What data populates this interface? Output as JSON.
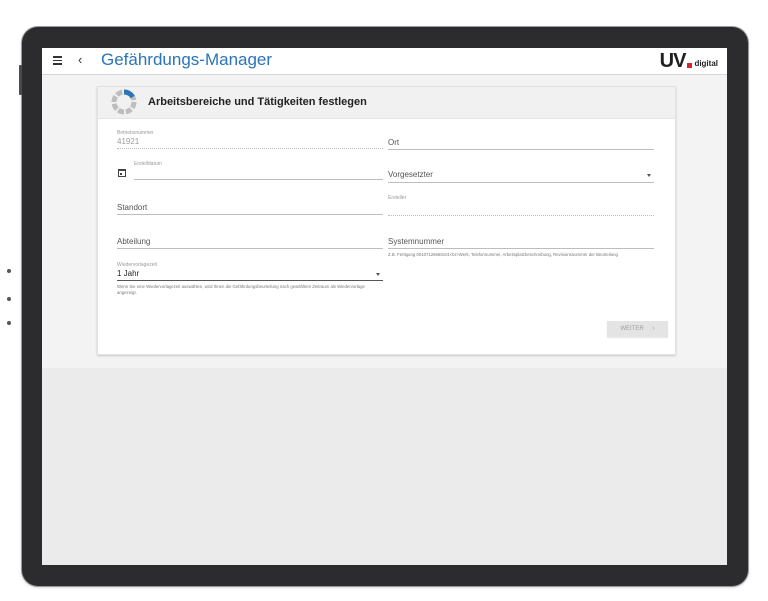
{
  "app": {
    "title": "Gefährdungs-Manager",
    "back_glyph": "‹",
    "logo": {
      "text": "UV",
      "suffix": "digital",
      "accent": "#d8232a"
    },
    "title_color": "#2a74b8"
  },
  "card": {
    "title": "Arbeitsbereiche und Tätigkeiten festlegen",
    "icon": "progress-ring-icon"
  },
  "form": {
    "betriebsnummer": {
      "label": "Betriebsnummer",
      "value": "41921"
    },
    "ort": {
      "placeholder": "Ort"
    },
    "erstelldatum": {
      "label": "Erstelldatum",
      "value": ""
    },
    "vorgesetzter": {
      "placeholder": "Vorgesetzter"
    },
    "standort": {
      "placeholder": "Standort"
    },
    "ersteller": {
      "label": "Ersteller",
      "value": ""
    },
    "abteilung": {
      "placeholder": "Abteilung"
    },
    "systemnummer": {
      "placeholder": "Systemnummer",
      "help": "Z.B. Fertigung 00107126668101<br>Werk, Telefonnummer, Arbeitsplatzbeschreibung, Revisionsnummer der Beurteilung"
    },
    "wiedervorlagezeit": {
      "label": "Wiedervorlagezeit",
      "value": "1 Jahr",
      "help": "Wenn Sie eine Wiedervorlagezeit auswählen, wird Ihnen die Gefährdungsbeurteilung nach gewähltem Zeitraum als Wiedervorlage angezeigt."
    }
  },
  "actions": {
    "weiter_label": "WEITER",
    "weiter_arrow": "›"
  }
}
